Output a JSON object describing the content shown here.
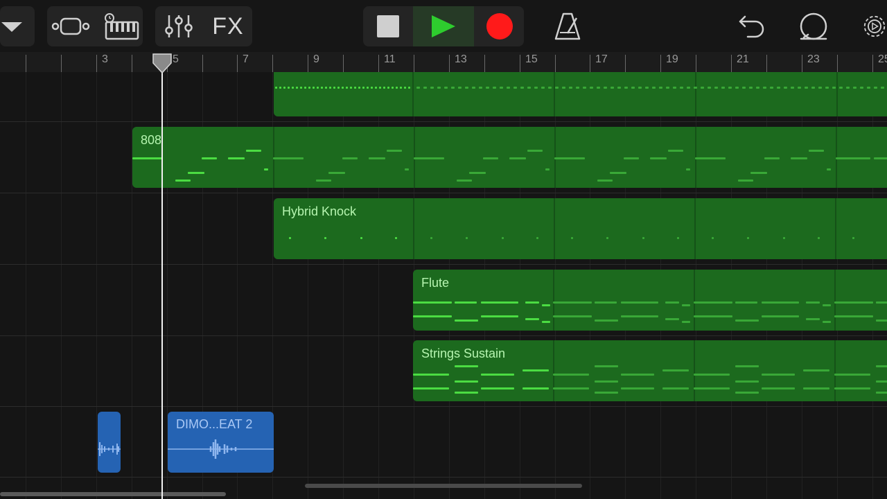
{
  "toolbar": {
    "fx_label": "FX",
    "transport": {
      "stop": "stop-icon",
      "play": "play-icon",
      "record": "record-icon",
      "play_color": "#2ecc2e",
      "record_color": "#ff1a1a"
    },
    "icons": [
      "dropdown-icon",
      "tracks-view-icon",
      "smart-keyboard-icon",
      "mixer-icon",
      "metronome-icon",
      "undo-icon",
      "loop-browser-icon",
      "settings-icon"
    ]
  },
  "ruler": {
    "bar_numbers": [
      "3",
      "5",
      "7",
      "9",
      "11",
      "13",
      "15",
      "17",
      "19",
      "21",
      "23",
      "25"
    ]
  },
  "tracks": [
    {
      "name": "808",
      "color": "#1c6a1e"
    },
    {
      "name": "Hybrid Knock",
      "color": "#1c6a1e"
    },
    {
      "name": "Flute",
      "color": "#1c6a1e"
    },
    {
      "name": "Strings Sustain",
      "color": "#1c6a1e"
    },
    {
      "name": "DIMO...EAT 2",
      "color": "#2563b3"
    }
  ]
}
